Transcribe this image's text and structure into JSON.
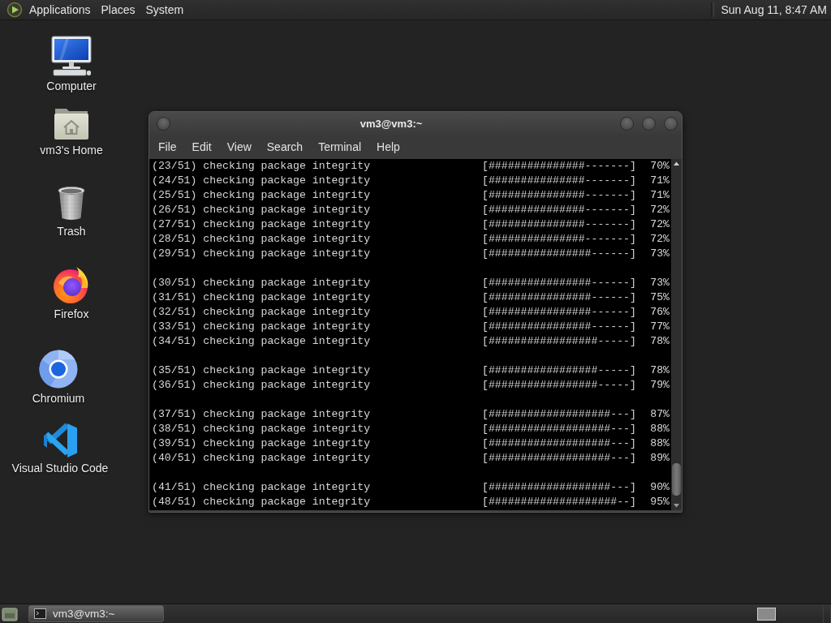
{
  "top_panel": {
    "menus": [
      "Applications",
      "Places",
      "System"
    ],
    "clock": "Sun Aug 11, 8:47 AM"
  },
  "desktop_icons": [
    {
      "kind": "computer",
      "label": "Computer"
    },
    {
      "kind": "home",
      "label": "vm3's Home"
    },
    {
      "kind": "trash",
      "label": "Trash"
    },
    {
      "kind": "firefox",
      "label": "Firefox"
    },
    {
      "kind": "chromium",
      "label": "Chromium"
    },
    {
      "kind": "vscode",
      "label": "Visual Studio Code"
    }
  ],
  "terminal": {
    "title": "vm3@vm3:~",
    "menus": [
      "File",
      "Edit",
      "View",
      "Search",
      "Terminal",
      "Help"
    ],
    "blocks": [
      [
        {
          "text": "(23/51) checking package integrity",
          "bar": "[###############-------]",
          "percent": "70%"
        },
        {
          "text": "(24/51) checking package integrity",
          "bar": "[###############-------]",
          "percent": "71%"
        },
        {
          "text": "(25/51) checking package integrity",
          "bar": "[###############-------]",
          "percent": "71%"
        },
        {
          "text": "(26/51) checking package integrity",
          "bar": "[###############-------]",
          "percent": "72%"
        },
        {
          "text": "(27/51) checking package integrity",
          "bar": "[###############-------]",
          "percent": "72%"
        },
        {
          "text": "(28/51) checking package integrity",
          "bar": "[###############-------]",
          "percent": "72%"
        },
        {
          "text": "(29/51) checking package integrity",
          "bar": "[################------]",
          "percent": "73%"
        }
      ],
      [
        {
          "text": "(30/51) checking package integrity",
          "bar": "[################------]",
          "percent": "73%"
        },
        {
          "text": "(31/51) checking package integrity",
          "bar": "[################------]",
          "percent": "75%"
        },
        {
          "text": "(32/51) checking package integrity",
          "bar": "[################------]",
          "percent": "76%"
        },
        {
          "text": "(33/51) checking package integrity",
          "bar": "[################------]",
          "percent": "77%"
        },
        {
          "text": "(34/51) checking package integrity",
          "bar": "[#################-----]",
          "percent": "78%"
        }
      ],
      [
        {
          "text": "(35/51) checking package integrity",
          "bar": "[#################-----]",
          "percent": "78%"
        },
        {
          "text": "(36/51) checking package integrity",
          "bar": "[#################-----]",
          "percent": "79%"
        }
      ],
      [
        {
          "text": "(37/51) checking package integrity",
          "bar": "[###################---]",
          "percent": "87%"
        },
        {
          "text": "(38/51) checking package integrity",
          "bar": "[###################---]",
          "percent": "88%"
        },
        {
          "text": "(39/51) checking package integrity",
          "bar": "[###################---]",
          "percent": "88%"
        },
        {
          "text": "(40/51) checking package integrity",
          "bar": "[###################---]",
          "percent": "89%"
        }
      ],
      [
        {
          "text": "(41/51) checking package integrity",
          "bar": "[###################---]",
          "percent": "90%"
        },
        {
          "text": "(48/51) checking package integrity",
          "bar": "[####################--]",
          "percent": "95%"
        }
      ]
    ]
  },
  "taskbar": {
    "tasks": [
      {
        "label": "vm3@vm3:~",
        "selected": true
      }
    ]
  }
}
